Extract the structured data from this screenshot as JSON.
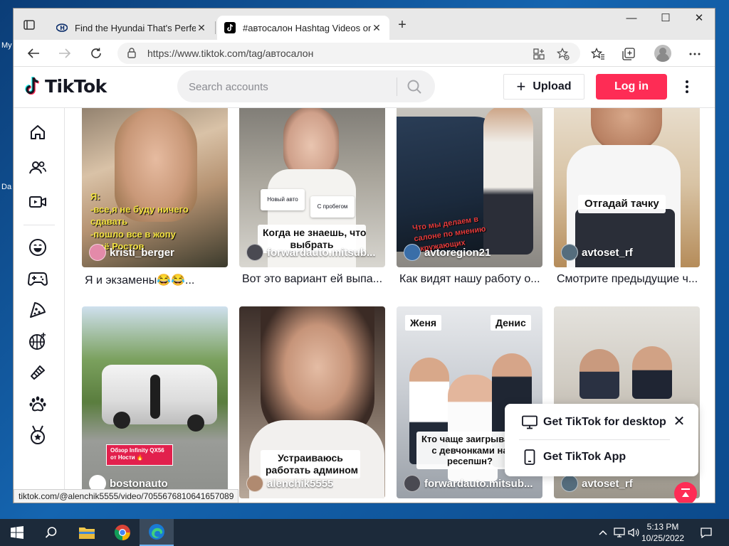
{
  "desktop": {
    "icon_labels": [
      "My",
      "Da"
    ]
  },
  "browser": {
    "tabs": [
      {
        "title": "Find the Hyundai That's Perfect F",
        "active": false
      },
      {
        "title": "#автосалон Hashtag Videos on",
        "active": true
      }
    ],
    "url": "https://www.tiktok.com/tag/автосалон",
    "status_url": "tiktok.com/@alenchik5555/video/7055676810641657089"
  },
  "tiktok": {
    "logo": "TikTok",
    "search_placeholder": "Search accounts",
    "upload_label": "Upload",
    "login_label": "Log in",
    "videos": [
      {
        "author": "kristi_berger",
        "caption": "Я и экзамены😂😂...",
        "overlay": "Я:\n-все,я не буду ничего\nсдавать\n-пошло все в жопу\n-всё,Ростов"
      },
      {
        "author": "forwardauto.mitsub...",
        "caption": "Вот это вариант ей выпа...",
        "overlay": "Когда не знаешь, что\nвыбрать",
        "card_left": "Новый авто",
        "card_right": "С пробегом"
      },
      {
        "author": "avtoregion21",
        "caption": "Как видят нашу работу о...",
        "overlay": "Что мы делаем в\nсалоне по мнению\nокружающих"
      },
      {
        "author": "avtoset_rf",
        "caption": "Смотрите предыдущие ч...",
        "overlay": "Отгадай тачку"
      },
      {
        "author": "bostonauto",
        "caption": "",
        "overlay": "Обзор Infinity QX56\nот Ности 🔥"
      },
      {
        "author": "alenchik5555",
        "caption": "",
        "overlay": "Устраиваюсь\nработать админом"
      },
      {
        "author": "forwardauto.mitsub...",
        "caption": "",
        "overlay": "Кто чаще заигрывает\nс девчонками на\nресепшн?",
        "name_left": "Женя",
        "name_right": "Денис"
      },
      {
        "author": "avtoset_rf",
        "caption": "",
        "overlay": ""
      }
    ],
    "popup": {
      "desktop_label": "Get TikTok for desktop",
      "app_label": "Get TikTok App"
    }
  },
  "taskbar": {
    "time": "5:13 PM",
    "date": "10/25/2022"
  },
  "colors": {
    "brand_red": "#fe2c55",
    "text": "#161823"
  }
}
